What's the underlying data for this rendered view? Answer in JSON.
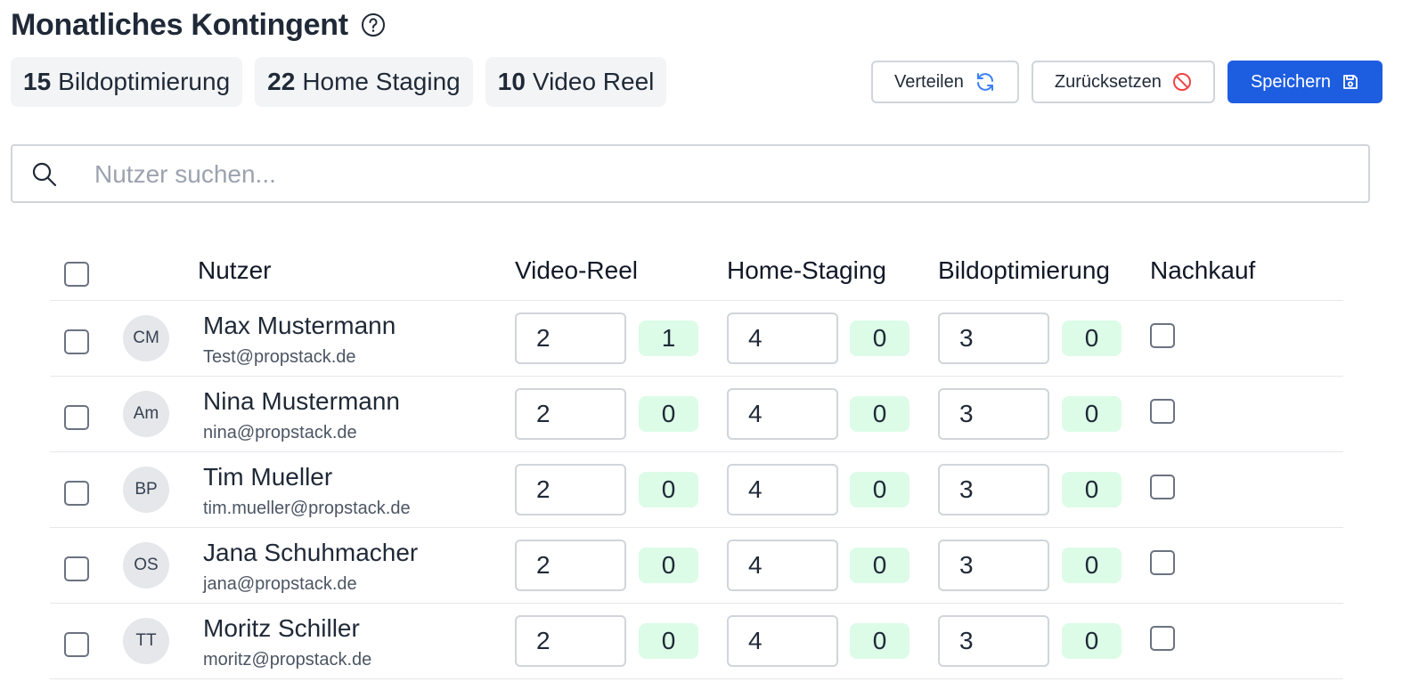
{
  "header": {
    "title": "Monatliches Kontingent"
  },
  "quota_chips": [
    {
      "count": "15",
      "label": "Bildoptimierung"
    },
    {
      "count": "22",
      "label": "Home Staging"
    },
    {
      "count": "10",
      "label": "Video Reel"
    }
  ],
  "actions": {
    "distribute_label": "Verteilen",
    "reset_label": "Zurücksetzen",
    "save_label": "Speichern"
  },
  "colors": {
    "primary": "#1d5de0",
    "badge_bg": "#dcfce7",
    "reset_icon": "#ef4444",
    "distribute_icon": "#3b82f6"
  },
  "search": {
    "placeholder": "Nutzer suchen...",
    "value": ""
  },
  "table": {
    "columns": {
      "user": "Nutzer",
      "video_reel": "Video-Reel",
      "home_staging": "Home-Staging",
      "bildoptimierung": "Bildoptimierung",
      "nachkauf": "Nachkauf"
    },
    "rows": [
      {
        "initials": "CM",
        "name": "Max Mustermann",
        "email": "Test@propstack.de",
        "video_reel": "2",
        "video_reel_used": "1",
        "home_staging": "4",
        "home_staging_used": "0",
        "bildoptimierung": "3",
        "bildoptimierung_used": "0",
        "nachkauf": false
      },
      {
        "initials": "Am",
        "name": "Nina Mustermann",
        "email": "nina@propstack.de",
        "video_reel": "2",
        "video_reel_used": "0",
        "home_staging": "4",
        "home_staging_used": "0",
        "bildoptimierung": "3",
        "bildoptimierung_used": "0",
        "nachkauf": false
      },
      {
        "initials": "BP",
        "name": "Tim Mueller",
        "email": "tim.mueller@propstack.de",
        "video_reel": "2",
        "video_reel_used": "0",
        "home_staging": "4",
        "home_staging_used": "0",
        "bildoptimierung": "3",
        "bildoptimierung_used": "0",
        "nachkauf": false
      },
      {
        "initials": "OS",
        "name": "Jana Schuhmacher",
        "email": "jana@propstack.de",
        "video_reel": "2",
        "video_reel_used": "0",
        "home_staging": "4",
        "home_staging_used": "0",
        "bildoptimierung": "3",
        "bildoptimierung_used": "0",
        "nachkauf": false
      },
      {
        "initials": "TT",
        "name": "Moritz Schiller",
        "email": "moritz@propstack.de",
        "video_reel": "2",
        "video_reel_used": "0",
        "home_staging": "4",
        "home_staging_used": "0",
        "bildoptimierung": "3",
        "bildoptimierung_used": "0",
        "nachkauf": false
      }
    ]
  }
}
